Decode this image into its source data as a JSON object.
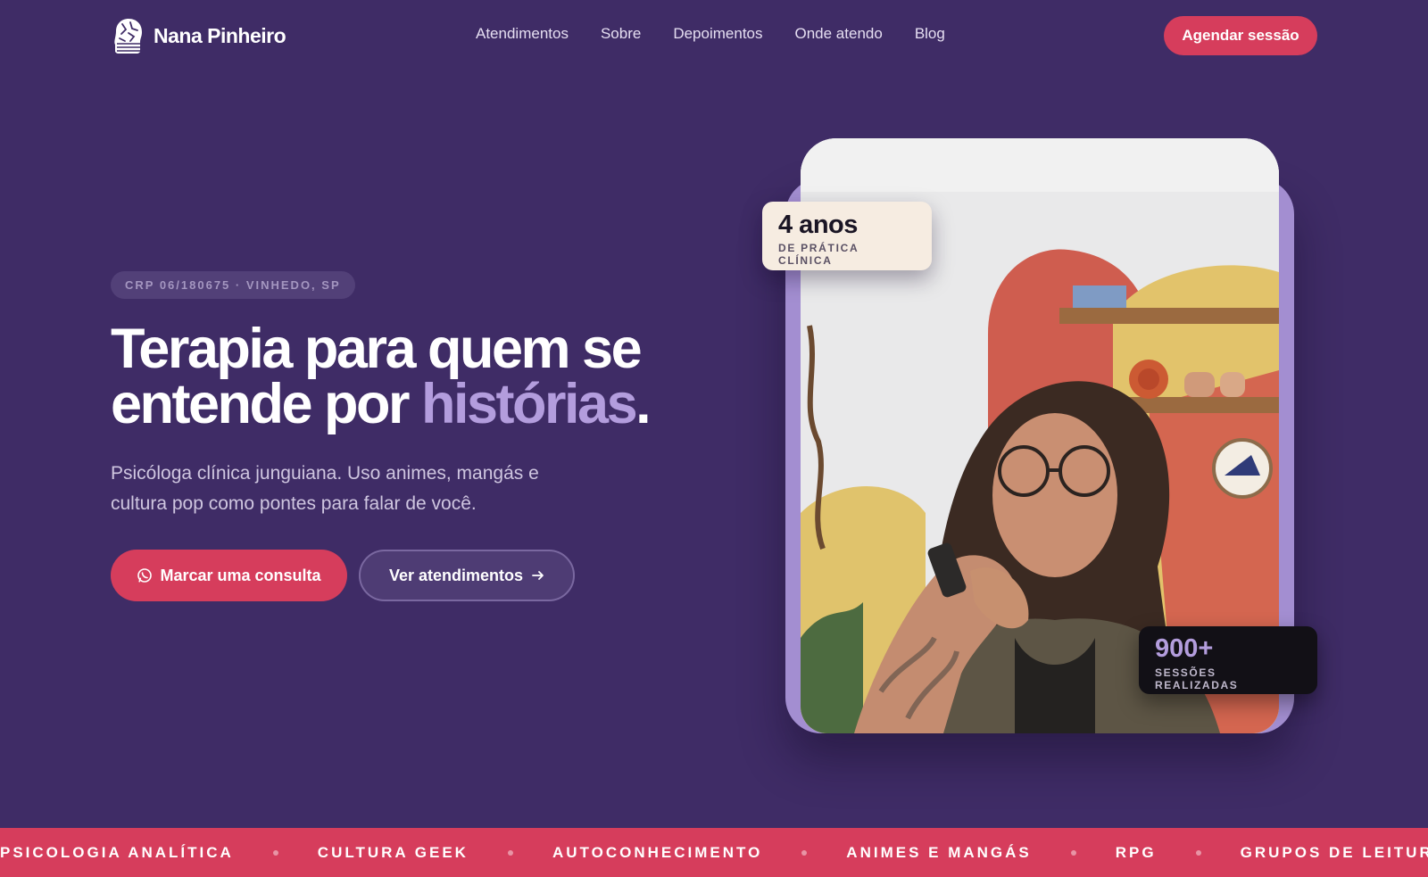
{
  "brand": {
    "name": "Nana Pinheiro",
    "logo_icon": "brain-icon"
  },
  "nav": {
    "links": [
      "Atendimentos",
      "Sobre",
      "Depoimentos",
      "Onde atendo",
      "Blog"
    ],
    "cta": "Agendar sessão"
  },
  "hero": {
    "badge": "CRP 06/180675 · VINHEDO, SP",
    "headline_part1": "Terapia para quem se entende por ",
    "headline_highlight": "histórias",
    "headline_end": ".",
    "subtitle": "Psicóloga clínica junguiana. Uso animes, mangás e cultura pop como pontes para falar de você.",
    "primary_cta": "Marcar uma consulta",
    "primary_cta_icon": "whatsapp-icon",
    "secondary_cta": "Ver atendimentos",
    "secondary_cta_icon": "arrow-right-icon"
  },
  "stats": {
    "years_value": "4 anos",
    "years_label": "DE PRÁTICA CLÍNICA",
    "sessions_value": "900+",
    "sessions_label": "SESSÕES REALIZADAS"
  },
  "marquee": {
    "items": [
      "PSICOLOGIA ANALÍTICA",
      "CULTURA GEEK",
      "AUTOCONHECIMENTO",
      "ANIMES E MANGÁS",
      "RPG",
      "GRUPOS DE LEITURA"
    ]
  },
  "colors": {
    "background": "#3f2c66",
    "accent": "#d63d5c",
    "highlight": "#b39ddd",
    "photo_frame": "#a38ed1"
  }
}
